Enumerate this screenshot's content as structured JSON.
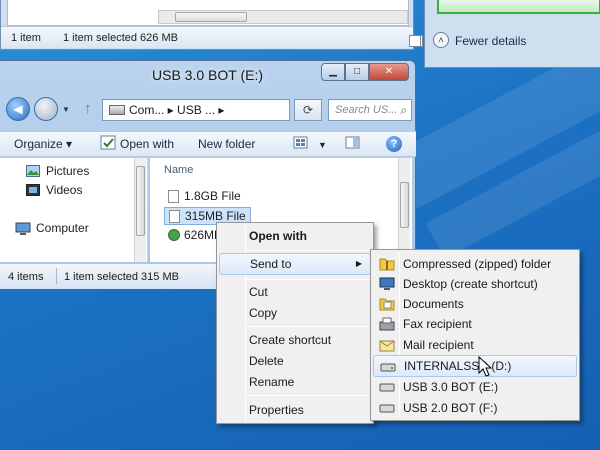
{
  "bg_window": {
    "status_items": "1 item",
    "status_selected": "1 item selected  626 MB"
  },
  "right_window": {
    "fewer_details": "Fewer details"
  },
  "explorer": {
    "title": "USB 3.0 BOT (E:)",
    "address": "Com... ▸ USB ... ▸",
    "search_placeholder": "Search US...",
    "toolbar": {
      "organize": "Organize ▾",
      "open_with": "Open with",
      "new_folder": "New folder"
    },
    "nav": {
      "pictures": "Pictures",
      "videos": "Videos",
      "computer": "Computer"
    },
    "column_name": "Name",
    "files": [
      {
        "name": "1.8GB File"
      },
      {
        "name": "315MB File"
      },
      {
        "name": "626MB"
      }
    ],
    "status": {
      "items": "4 items",
      "selected": "1 item selected  315 MB"
    }
  },
  "context_menu": {
    "open_with": "Open with",
    "send_to": "Send to",
    "cut": "Cut",
    "copy": "Copy",
    "create_shortcut": "Create shortcut",
    "delete": "Delete",
    "rename": "Rename",
    "properties": "Properties"
  },
  "send_to_menu": {
    "items": [
      {
        "label": "Compressed (zipped) folder",
        "icon": "zip-folder-icon"
      },
      {
        "label": "Desktop (create shortcut)",
        "icon": "desktop-icon"
      },
      {
        "label": "Documents",
        "icon": "documents-icon"
      },
      {
        "label": "Fax recipient",
        "icon": "fax-icon"
      },
      {
        "label": "Mail recipient",
        "icon": "mail-icon"
      },
      {
        "label": "INTERNALSSD (D:)",
        "icon": "drive-icon"
      },
      {
        "label": "USB 3.0 BOT (E:)",
        "icon": "drive-icon"
      },
      {
        "label": "USB 2.0 BOT (F:)",
        "icon": "drive-icon"
      }
    ]
  },
  "colors": {
    "desktop": "#1c72c4",
    "selection": "#cde3fb",
    "menu_bg": "#f0f0f0"
  }
}
